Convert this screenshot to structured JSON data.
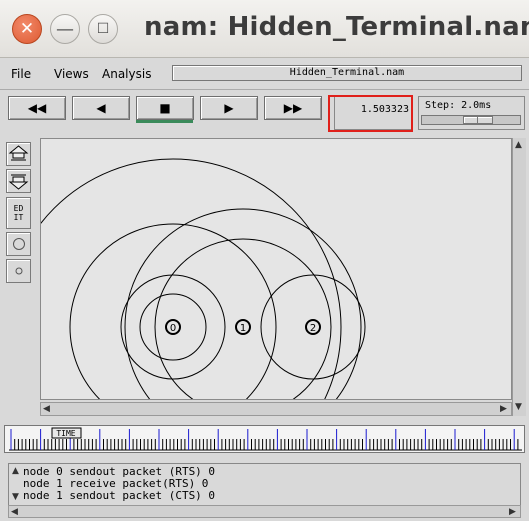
{
  "window": {
    "title": "nam: Hidden_Terminal.nam",
    "close_glyph": "✕",
    "min_glyph": "—",
    "max_glyph": "☐"
  },
  "menu": {
    "file": "File",
    "views": "Views",
    "analysis": "Analysis",
    "filename": "Hidden_Terminal.nam"
  },
  "controls": {
    "rewind": "◀◀",
    "back": "◀",
    "stop": "■",
    "play": "▶",
    "fast_forward": "▶▶",
    "time": "1.503323",
    "step_label": "Step: 2.0ms",
    "step_position_fraction": 0.5
  },
  "tools": {
    "edit_label_1": "ED",
    "edit_label_2": "IT"
  },
  "nodes": [
    {
      "id": "0"
    },
    {
      "id": "1"
    },
    {
      "id": "2"
    }
  ],
  "timeline": {
    "marker_label": "TIME"
  },
  "log": {
    "lines": [
      "node 0 sendout packet (RTS) 0",
      "node 1 receive packet(RTS) 0",
      "node 1 sendout packet (CTS) 0"
    ]
  },
  "colors": {
    "highlight": "#e0201a",
    "stop_indicator": "#3a8a5a",
    "timeline_ticks": "#1a1ad0"
  }
}
